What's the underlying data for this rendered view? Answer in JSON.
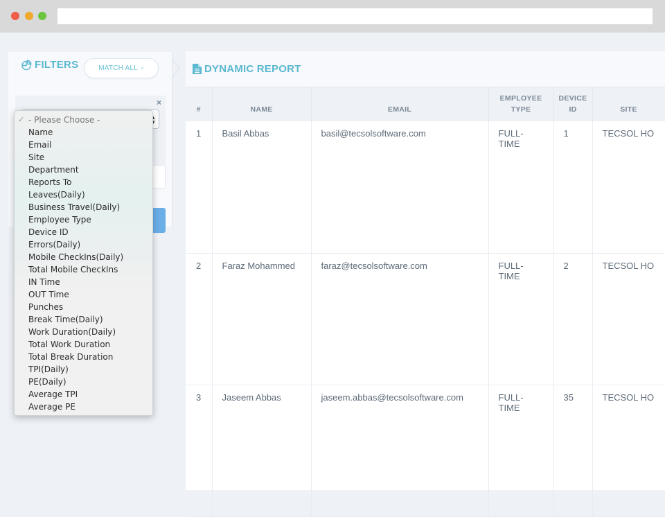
{
  "window": {
    "controls": [
      "close",
      "minimize",
      "maximize"
    ],
    "url": ""
  },
  "filters": {
    "title": "FILTERS",
    "icon": "pie-chart-icon",
    "match_button": "MATCH ALL",
    "match_chevron": "˅",
    "remove_icon": "×",
    "select_current": "- Please Choose -"
  },
  "dropdown": {
    "checkmark": "✓",
    "options": [
      "- Please Choose -",
      "Name",
      "Email",
      "Site",
      "Department",
      "Reports To",
      "Leaves(Daily)",
      "Business Travel(Daily)",
      "Employee Type",
      "Device ID",
      "Errors(Daily)",
      "Mobile CheckIns(Daily)",
      "Total Mobile CheckIns",
      "IN Time",
      "OUT Time",
      "Punches",
      "Break Time(Daily)",
      "Work Duration(Daily)",
      "Total Work Duration",
      "Total Break Duration",
      "TPI(Daily)",
      "PE(Daily)",
      "Average TPI",
      "Average PE"
    ],
    "selected_index": 0
  },
  "report": {
    "title": "DYNAMIC REPORT",
    "icon": "document-icon",
    "columns": [
      "#",
      "NAME",
      "EMAIL",
      "EMPLOYEE TYPE",
      "DEVICE ID",
      "SITE"
    ],
    "rows": [
      {
        "num": "1",
        "name": "Basil Abbas",
        "email": "basil@tecsolsoftware.com",
        "type": "FULL-TIME",
        "device": "1",
        "site": "TECSOL HO"
      },
      {
        "num": "2",
        "name": "Faraz Mohammed",
        "email": "faraz@tecsolsoftware.com",
        "type": "FULL-TIME",
        "device": "2",
        "site": "TECSOL HO"
      },
      {
        "num": "3",
        "name": "Jaseem Abbas",
        "email": "jaseem.abbas@tecsolsoftware.com",
        "type": "FULL-TIME",
        "device": "35",
        "site": "TECSOL HO"
      }
    ]
  },
  "colors": {
    "accent": "#5bb8d0",
    "primary_button": "#6aaee8",
    "background": "#eef2f7"
  }
}
